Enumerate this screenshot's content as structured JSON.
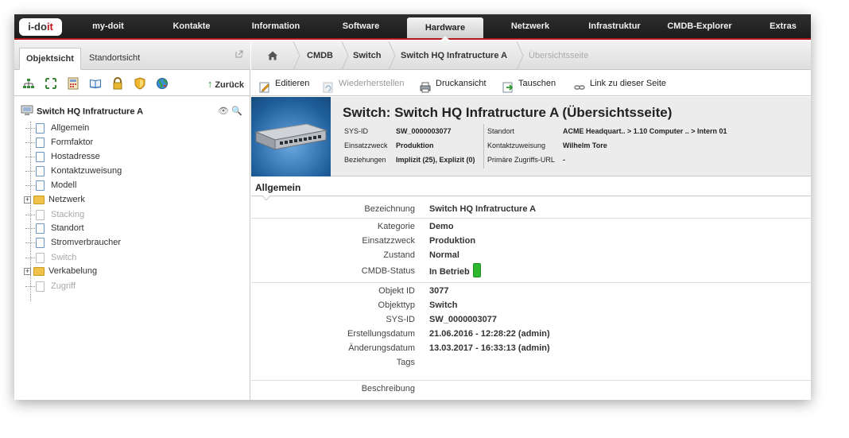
{
  "logo": {
    "text_pre": "i-do",
    "text_red": "it"
  },
  "nav": {
    "items": [
      {
        "label": "my-doit"
      },
      {
        "label": "Kontakte"
      },
      {
        "label": "Information"
      },
      {
        "label": "Software"
      },
      {
        "label": "Hardware"
      },
      {
        "label": "Netzwerk"
      },
      {
        "label": "Infrastruktur"
      },
      {
        "label": "CMDB-Explorer"
      },
      {
        "label": "Extras"
      }
    ],
    "active": "Hardware"
  },
  "left": {
    "tabs": [
      {
        "label": "Objektsicht"
      },
      {
        "label": "Standortsicht"
      }
    ],
    "back_label": "Zurück",
    "icons": [
      "network-icon",
      "expand-icon",
      "calculator-icon",
      "book-icon",
      "lock-icon",
      "shield-icon",
      "globe-icon"
    ],
    "tree": {
      "root": "Switch HQ Infratructure A",
      "items": [
        {
          "label": "Allgemein",
          "kind": "doc"
        },
        {
          "label": "Formfaktor",
          "kind": "doc"
        },
        {
          "label": "Hostadresse",
          "kind": "doc"
        },
        {
          "label": "Kontaktzuweisung",
          "kind": "doc"
        },
        {
          "label": "Modell",
          "kind": "doc"
        },
        {
          "label": "Netzwerk",
          "kind": "folder"
        },
        {
          "label": "Stacking",
          "kind": "doc-disabled"
        },
        {
          "label": "Standort",
          "kind": "doc"
        },
        {
          "label": "Stromverbraucher",
          "kind": "doc"
        },
        {
          "label": "Switch",
          "kind": "doc-disabled"
        },
        {
          "label": "Verkabelung",
          "kind": "folder"
        },
        {
          "label": "Zugriff",
          "kind": "doc-disabled"
        }
      ]
    }
  },
  "breadcrumb": [
    "CMDB",
    "Switch",
    "Switch HQ Infratructure A",
    "Übersichtsseite"
  ],
  "toolbar": {
    "edit": "Editieren",
    "restore": "Wiederherstellen",
    "print": "Druckansicht",
    "swap": "Tauschen",
    "link": "Link zu dieser Seite"
  },
  "object": {
    "title": "Switch: Switch HQ Infratructure A (Übersichtsseite)",
    "sysid_label": "SYS-ID",
    "sysid": "SW_0000003077",
    "purpose_label": "Einsatzzweck",
    "purpose": "Produktion",
    "relations_label": "Beziehungen",
    "relations": "Implizit (25), Explizit (0)",
    "location_label": "Standort",
    "location": "ACME Headquart.. > 1.10 Computer .. > Intern 01",
    "contact_label": "Kontaktzuweisung",
    "contact": "Wilhelm Tore",
    "access_label": "Primäre Zugriffs-URL",
    "access": "-"
  },
  "section": {
    "title": "Allgemein"
  },
  "fields": {
    "bezeichnung": {
      "label": "Bezeichnung",
      "value": "Switch HQ Infratructure A"
    },
    "kategorie": {
      "label": "Kategorie",
      "value": "Demo"
    },
    "einsatzzweck": {
      "label": "Einsatzzweck",
      "value": "Produktion"
    },
    "zustand": {
      "label": "Zustand",
      "value": "Normal"
    },
    "cmdb_status": {
      "label": "CMDB-Status",
      "value": "In Betrieb",
      "color": "#2db82d"
    },
    "objekt_id": {
      "label": "Objekt ID",
      "value": "3077"
    },
    "objekttyp": {
      "label": "Objekttyp",
      "value": "Switch"
    },
    "sys_id": {
      "label": "SYS-ID",
      "value": "SW_0000003077"
    },
    "erstellungsdatum": {
      "label": "Erstellungsdatum",
      "value": "21.06.2016 - 12:28:22 (admin)"
    },
    "aenderungsdatum": {
      "label": "Änderungsdatum",
      "value": "13.03.2017 - 16:33:13 (admin)"
    },
    "tags": {
      "label": "Tags",
      "value": ""
    },
    "beschreibung": {
      "label": "Beschreibung",
      "value": ""
    }
  },
  "colors": {
    "accent": "#b3191c",
    "nav_bg": "#222222",
    "status_green": "#2db82d"
  }
}
